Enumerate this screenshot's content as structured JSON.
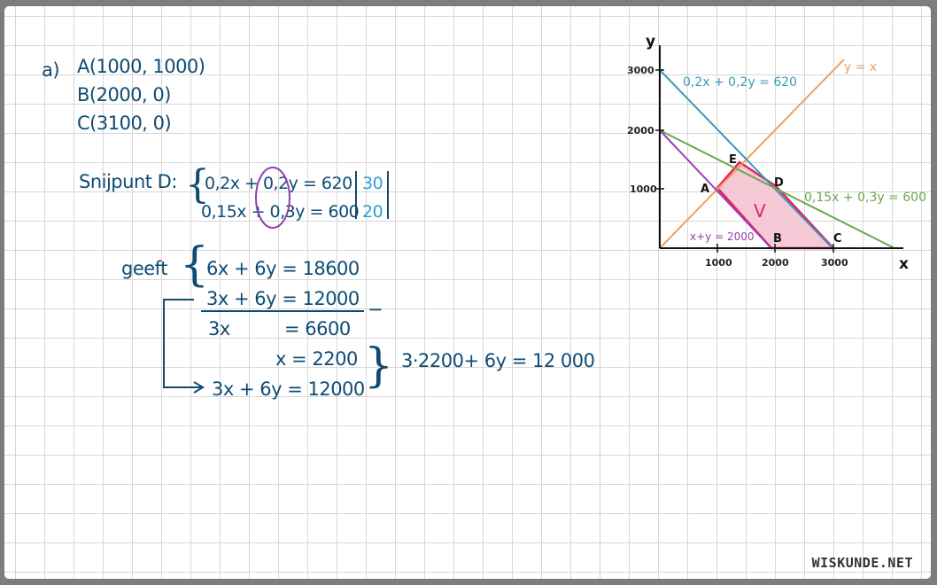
{
  "part_label": "a)",
  "points": {
    "a": "A(1000, 1000)",
    "b": "B(2000, 0)",
    "c": "C(3100, 0)"
  },
  "intersection": {
    "label": "Snijpunt D:",
    "eq1": "0,2x + 0,2y = 620",
    "eq2": "0,15x + 0,3y = 600",
    "mult1": "30",
    "mult2": "20"
  },
  "solution": {
    "label": "geeft",
    "line1": "6x + 6y = 18600",
    "line2": "3x + 6y = 12000",
    "minus": "−",
    "diff_left": "3x",
    "diff_right": "= 6600",
    "x_value": "x = 2200",
    "substitute": "3x + 6y = 12000",
    "substitution": "3·2200+ 6y = 12 000"
  },
  "graph": {
    "axis_x_label": "x",
    "axis_y_label": "y",
    "x_ticks": [
      "1000",
      "2000",
      "3000"
    ],
    "y_ticks": [
      "1000",
      "2000",
      "3000"
    ],
    "lines": [
      {
        "label": "y = x",
        "color": "#f0a060"
      },
      {
        "label": "0,2x + 0,2y = 620",
        "color": "#3a9ab8"
      },
      {
        "label": "0,15x + 0,3y = 600",
        "color": "#6aa84f"
      },
      {
        "label": "x+y = 2000",
        "color": "#9b3fb3"
      }
    ],
    "region_label": "V",
    "region_color": "#e0245e",
    "vertices": [
      "A",
      "B",
      "C",
      "D",
      "E"
    ]
  },
  "watermark": "WISKUNDE.NET"
}
